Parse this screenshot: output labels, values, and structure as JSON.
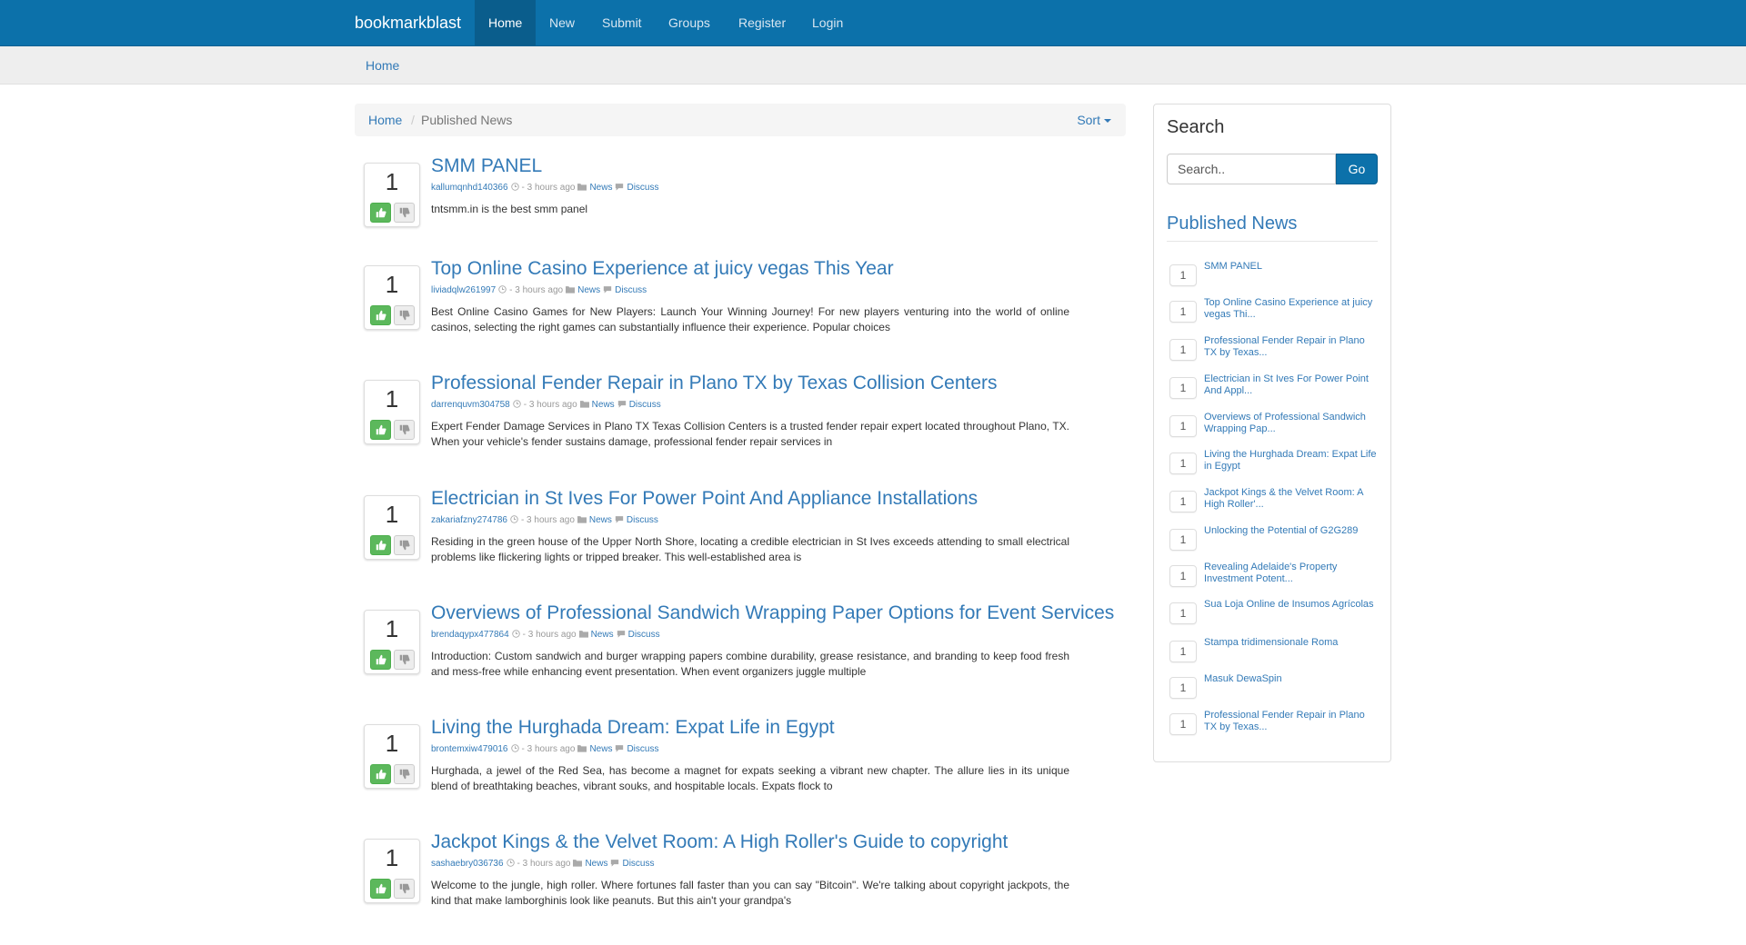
{
  "navbar": {
    "brand": "bookmarkblast",
    "items": [
      {
        "label": "Home",
        "active": true
      },
      {
        "label": "New"
      },
      {
        "label": "Submit"
      },
      {
        "label": "Groups"
      },
      {
        "label": "Register"
      },
      {
        "label": "Login"
      }
    ]
  },
  "subbar": {
    "home": "Home"
  },
  "breadcrumb": {
    "home": "Home",
    "separator": "/",
    "current": "Published News",
    "sort": "Sort"
  },
  "colors": {
    "navbar": "#0c71aa",
    "link": "#337ab7",
    "vote_up": "#5cb85c"
  },
  "posts": [
    {
      "votes": "1",
      "title": "SMM PANEL",
      "user": "kallumqnhd140366",
      "time": "- 3 hours ago",
      "category": "News",
      "discuss": "Discuss",
      "desc": "tntsmm.in is the best smm panel"
    },
    {
      "votes": "1",
      "title": "Top Online Casino Experience at juicy vegas This Year",
      "user": "liviadqlw261997",
      "time": "- 3 hours ago",
      "category": "News",
      "discuss": "Discuss",
      "desc": "Best Online Casino Games for New Players: Launch Your Winning Journey! For new players venturing into the world of online casinos, selecting the right games can substantially influence their experience. Popular choices"
    },
    {
      "votes": "1",
      "title": "Professional Fender Repair in Plano TX by Texas Collision Centers",
      "user": "darrenquvm304758",
      "time": "- 3 hours ago",
      "category": "News",
      "discuss": "Discuss",
      "desc": "Expert Fender Damage Services in Plano TX Texas Collision Centers is a trusted fender repair expert located throughout Plano, TX. When your vehicle's fender sustains damage, professional fender repair services in"
    },
    {
      "votes": "1",
      "title": "Electrician in St Ives For Power Point And Appliance Installations",
      "user": "zakariafzny274786",
      "time": "- 3 hours ago",
      "category": "News",
      "discuss": "Discuss",
      "desc": "Residing in the green house of the Upper North Shore, locating a credible electrician in St Ives exceeds attending to small electrical problems like flickering lights or tripped breaker. This well-established area is"
    },
    {
      "votes": "1",
      "title": "Overviews of Professional Sandwich Wrapping Paper Options for Event Services",
      "user": "brendaqypx477864",
      "time": "- 3 hours ago",
      "category": "News",
      "discuss": "Discuss",
      "desc": "Introduction: Custom sandwich and burger wrapping papers combine durability, grease resistance, and branding to keep food fresh and mess-free while enhancing event presentation. When event organizers juggle multiple"
    },
    {
      "votes": "1",
      "title": "Living the Hurghada Dream: Expat Life in Egypt",
      "user": "brontemxiw479016",
      "time": "- 3 hours ago",
      "category": "News",
      "discuss": "Discuss",
      "desc": "Hurghada, a jewel of the Red Sea, has become a magnet for expats seeking a vibrant new chapter. The allure lies in its unique blend of breathtaking beaches, vibrant souks, and hospitable locals. Expats flock to"
    },
    {
      "votes": "1",
      "title": "Jackpot Kings & the Velvet Room: A High Roller's Guide to copyright",
      "user": "sashaebry036736",
      "time": "- 3 hours ago",
      "category": "News",
      "discuss": "Discuss",
      "desc": "Welcome to the jungle, high roller. Where fortunes fall faster than you can say \"Bitcoin\". We're talking about copyright jackpots, the kind that make lamborghinis look like peanuts. But this ain't your grandpa's"
    }
  ],
  "sidebar": {
    "search_title": "Search",
    "search_placeholder": "Search..",
    "go_label": "Go",
    "news_title": "Published News",
    "items": [
      {
        "count": "1",
        "label": "SMM PANEL"
      },
      {
        "count": "1",
        "label": "Top Online Casino Experience at juicy vegas Thi..."
      },
      {
        "count": "1",
        "label": "Professional Fender Repair in Plano TX by Texas..."
      },
      {
        "count": "1",
        "label": "Electrician in St Ives For Power Point And Appl..."
      },
      {
        "count": "1",
        "label": "Overviews of Professional Sandwich Wrapping Pap..."
      },
      {
        "count": "1",
        "label": "Living the Hurghada Dream: Expat Life in Egypt"
      },
      {
        "count": "1",
        "label": "Jackpot Kings & the Velvet Room: A High Roller'..."
      },
      {
        "count": "1",
        "label": "Unlocking the Potential of G2G289"
      },
      {
        "count": "1",
        "label": "Revealing Adelaide's Property Investment Potent..."
      },
      {
        "count": "1",
        "label": "Sua Loja Online de Insumos Agrícolas"
      },
      {
        "count": "1",
        "label": "Stampa tridimensionale Roma"
      },
      {
        "count": "1",
        "label": "Masuk DewaSpin"
      },
      {
        "count": "1",
        "label": "Professional Fender Repair in Plano TX by Texas..."
      }
    ]
  }
}
